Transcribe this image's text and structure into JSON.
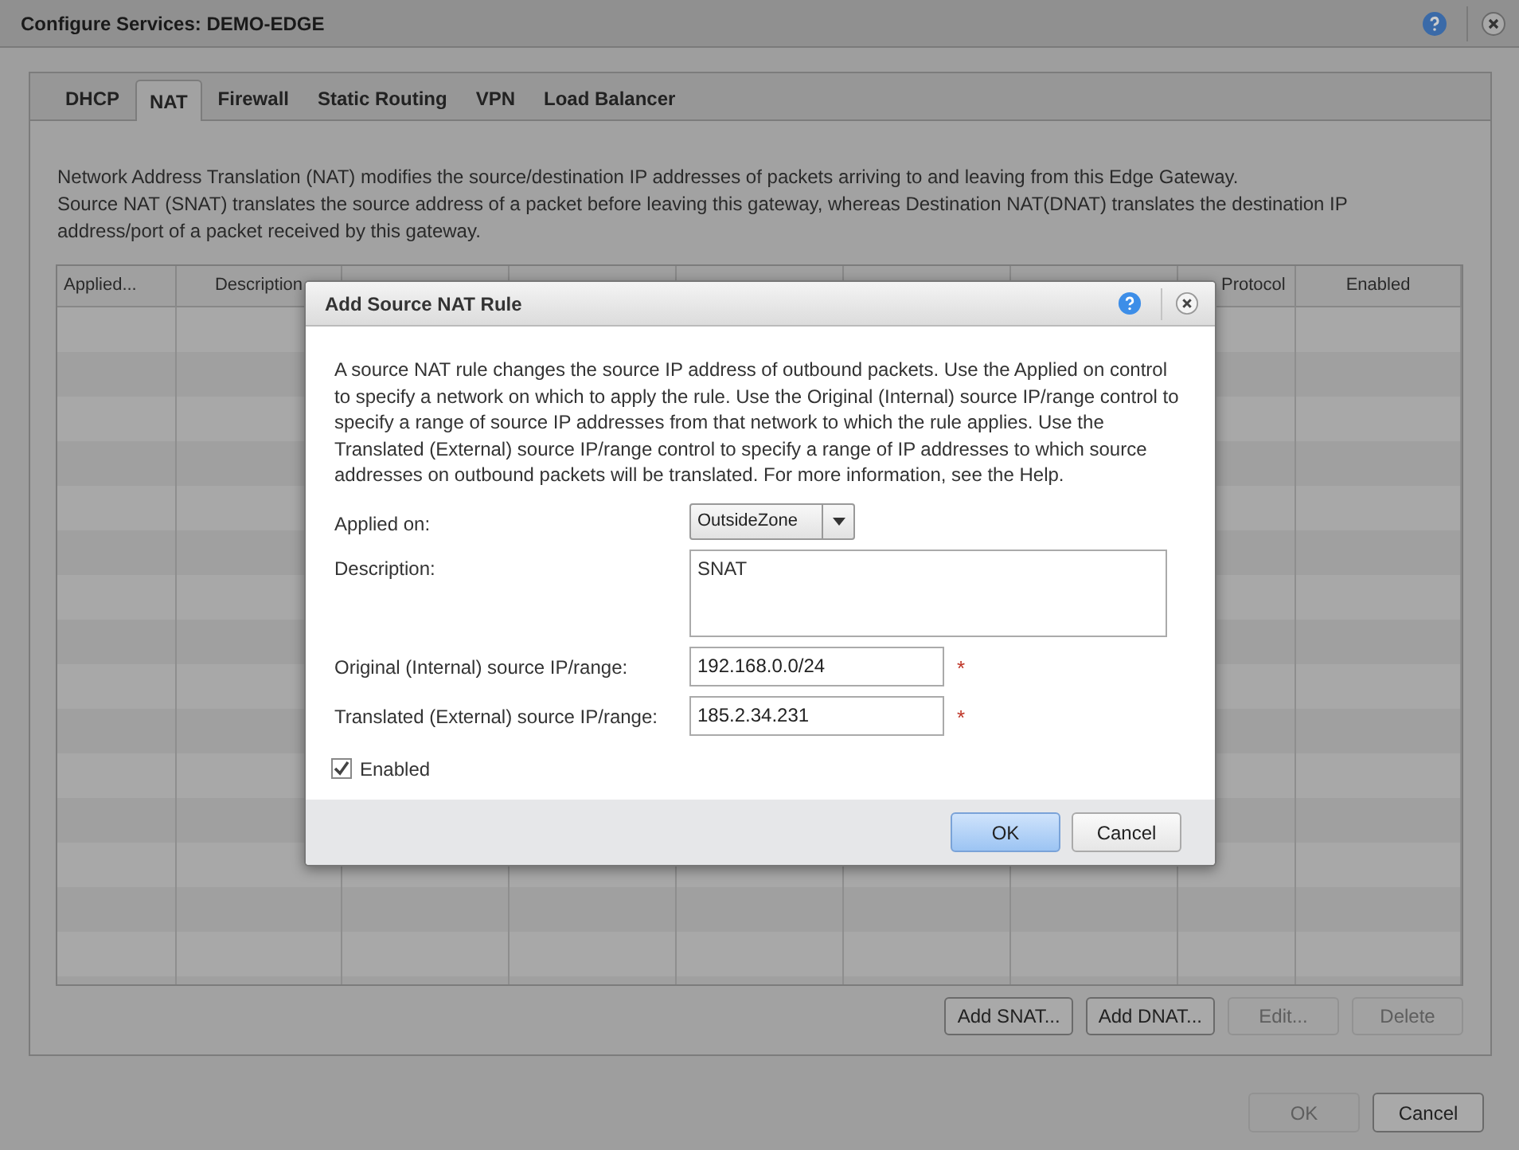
{
  "window": {
    "title": "Configure Services: DEMO-EDGE"
  },
  "tabs": [
    {
      "label": "DHCP",
      "selected": false
    },
    {
      "label": "NAT",
      "selected": true
    },
    {
      "label": "Firewall",
      "selected": false
    },
    {
      "label": "Static Routing",
      "selected": false
    },
    {
      "label": "VPN",
      "selected": false
    },
    {
      "label": "Load Balancer",
      "selected": false
    }
  ],
  "intro": [
    "Network Address Translation (NAT) modifies the source/destination IP addresses of packets arriving to and leaving from this Edge Gateway.",
    "Source NAT (SNAT) translates the source address of a packet before leaving this gateway, whereas Destination NAT(DNAT)  translates the destination IP address/port of a packet received by this gateway."
  ],
  "table": {
    "columns_left": [
      "Applied...",
      "Description"
    ],
    "columns_right": [
      "Protocol",
      "Enabled"
    ]
  },
  "table_buttons": [
    {
      "label": "Add SNAT...",
      "disabled": false
    },
    {
      "label": "Add DNAT...",
      "disabled": false
    },
    {
      "label": "Edit...",
      "disabled": true
    },
    {
      "label": "Delete",
      "disabled": true
    }
  ],
  "footer_buttons": [
    {
      "label": "OK",
      "disabled": true
    },
    {
      "label": "Cancel",
      "disabled": false
    }
  ],
  "dialog": {
    "title": "Add Source NAT Rule",
    "description": "A source NAT rule changes the source IP address of outbound packets. Use the Applied on control to specify a network on which to apply the rule. Use the Original (Internal) source IP/range control to specify a range of source IP addresses from that network to which the rule applies. Use the Translated (External) source IP/range control to specify a range of IP addresses to which source addresses on outbound packets will be translated. For more information, see the Help.",
    "fields": [
      {
        "kind": "select",
        "label": "Applied on:",
        "value": "OutsideZone"
      },
      {
        "kind": "textarea",
        "label": "Description:",
        "value": "SNAT"
      },
      {
        "kind": "text",
        "label": "Original (Internal) source IP/range:",
        "value": "192.168.0.0/24",
        "required_mark": "*"
      },
      {
        "kind": "text",
        "label": "Translated (External) source IP/range:",
        "value": "185.2.34.231",
        "required_mark": "*"
      }
    ],
    "enabled": {
      "label": "Enabled",
      "checked": true
    },
    "buttons": [
      {
        "label": "OK",
        "primary": true
      },
      {
        "label": "Cancel",
        "primary": false
      }
    ]
  }
}
